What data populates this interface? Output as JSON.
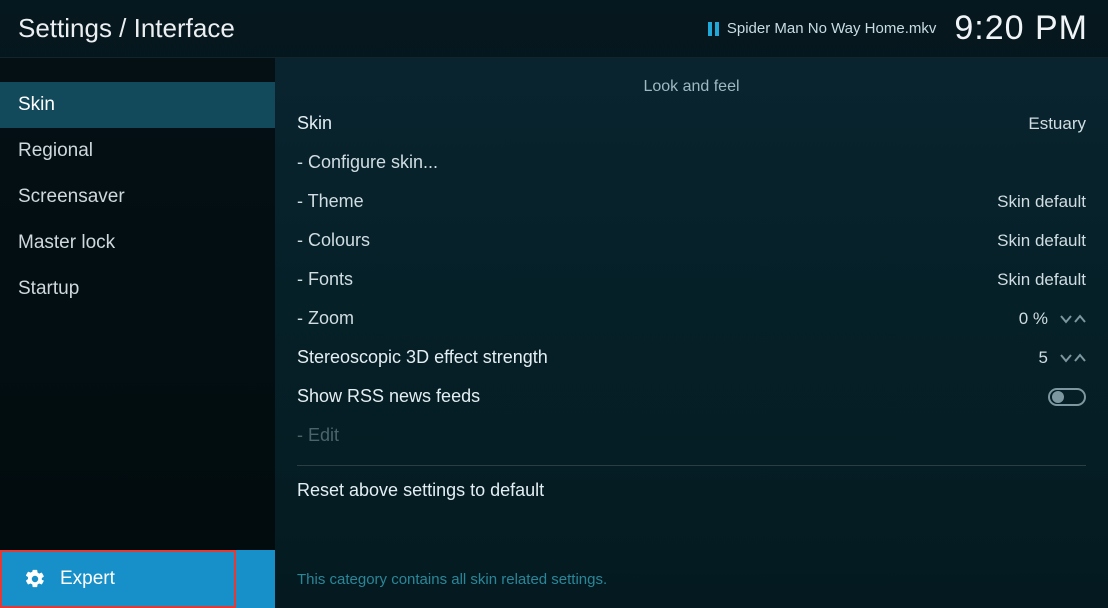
{
  "header": {
    "breadcrumb": "Settings / Interface",
    "now_playing": "Spider Man No Way Home.mkv",
    "clock": "9:20 PM"
  },
  "sidebar": {
    "items": [
      {
        "label": "Skin",
        "selected": true
      },
      {
        "label": "Regional",
        "selected": false
      },
      {
        "label": "Screensaver",
        "selected": false
      },
      {
        "label": "Master lock",
        "selected": false
      },
      {
        "label": "Startup",
        "selected": false
      }
    ],
    "level_label": "Expert"
  },
  "content": {
    "section_title": "Look and feel",
    "rows": {
      "skin_label": "Skin",
      "skin_value": "Estuary",
      "configure_label": "- Configure skin...",
      "theme_label": "- Theme",
      "theme_value": "Skin default",
      "colours_label": "- Colours",
      "colours_value": "Skin default",
      "fonts_label": "- Fonts",
      "fonts_value": "Skin default",
      "zoom_label": "- Zoom",
      "zoom_value": "0 %",
      "stereo_label": "Stereoscopic 3D effect strength",
      "stereo_value": "5",
      "rss_label": "Show RSS news feeds",
      "edit_label": "- Edit"
    },
    "reset_label": "Reset above settings to default",
    "help_text": "This category contains all skin related settings."
  }
}
